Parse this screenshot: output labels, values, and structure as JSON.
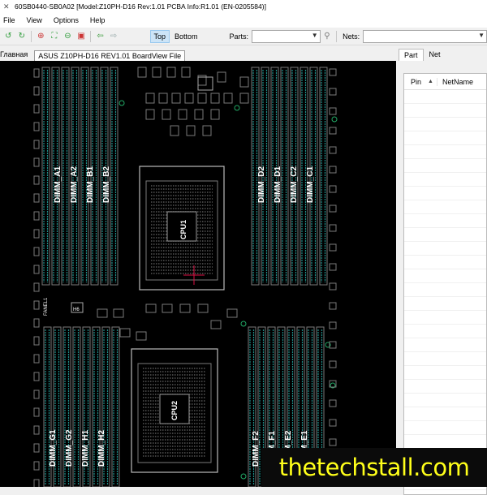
{
  "window": {
    "title": "60SB0440-SB0A02 [Model:Z10PH-D16 Rev:1.01 PCBA Info:R1.01  (EN-0205584)]"
  },
  "menu": [
    "File",
    "View",
    "Options",
    "Help"
  ],
  "toolbar": {
    "top_label": "Top",
    "bottom_label": "Bottom",
    "parts_label": "Parts:",
    "nets_label": "Nets:",
    "parts_value": "",
    "nets_value": ""
  },
  "docbar": {
    "home_label": "Главная",
    "file_tab": "ASUS Z10PH-D16 REV1.01 BoardView File"
  },
  "right_panel": {
    "tabs": [
      "Part",
      "Net"
    ],
    "columns": [
      "Pin",
      "NetName"
    ]
  },
  "board": {
    "dimm_labels_top_left": [
      "DIMM_A1",
      "DIMM_A2",
      "DIMM_B1",
      "DIMM_B2"
    ],
    "dimm_labels_top_right": [
      "DIMM_D2",
      "DIMM_D1",
      "DIMM_C2",
      "DIMM_C1"
    ],
    "dimm_labels_bottom_left": [
      "DIMM_G1",
      "DIMM_G2",
      "DIMM_H1",
      "DIMM_H2"
    ],
    "dimm_labels_bottom_right": [
      "DIMM_F2",
      "DIMM_F1",
      "DIMM_E2",
      "DIMM_E1"
    ],
    "cpu1_label": "CPU1",
    "cpu2_label": "CPU2",
    "small_labels": [
      "FANEL1",
      "H6"
    ],
    "trace_color": "#7a7a7a",
    "slot_accent": "#1f8f8a"
  },
  "watermark": "thetechstall.com",
  "colors": {
    "watermark_text": "#ffff1a",
    "board_bg": "#000000",
    "active_button": "#cce4f7"
  }
}
